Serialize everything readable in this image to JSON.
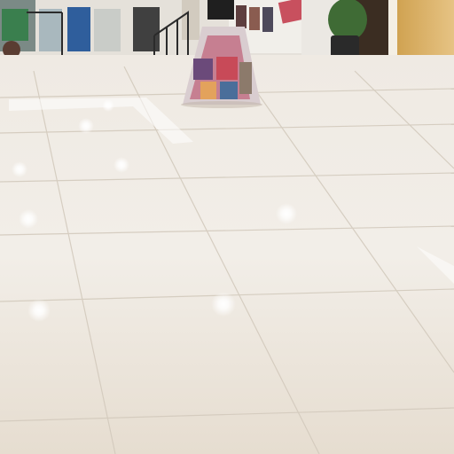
{
  "scene": {
    "type": "photo",
    "colors": {
      "floor_light": "#f3efe8",
      "floor_mid": "#e9e2d6",
      "floor_shadow": "#d8d0c2",
      "grout": "#cfc6b8",
      "wall": "#e8e5e0",
      "plant": "#3f6b35",
      "pot": "#2a2a2a",
      "storefront": "#d9b067",
      "railing": "#2b2b2b",
      "highlight": "#ffffff"
    }
  }
}
